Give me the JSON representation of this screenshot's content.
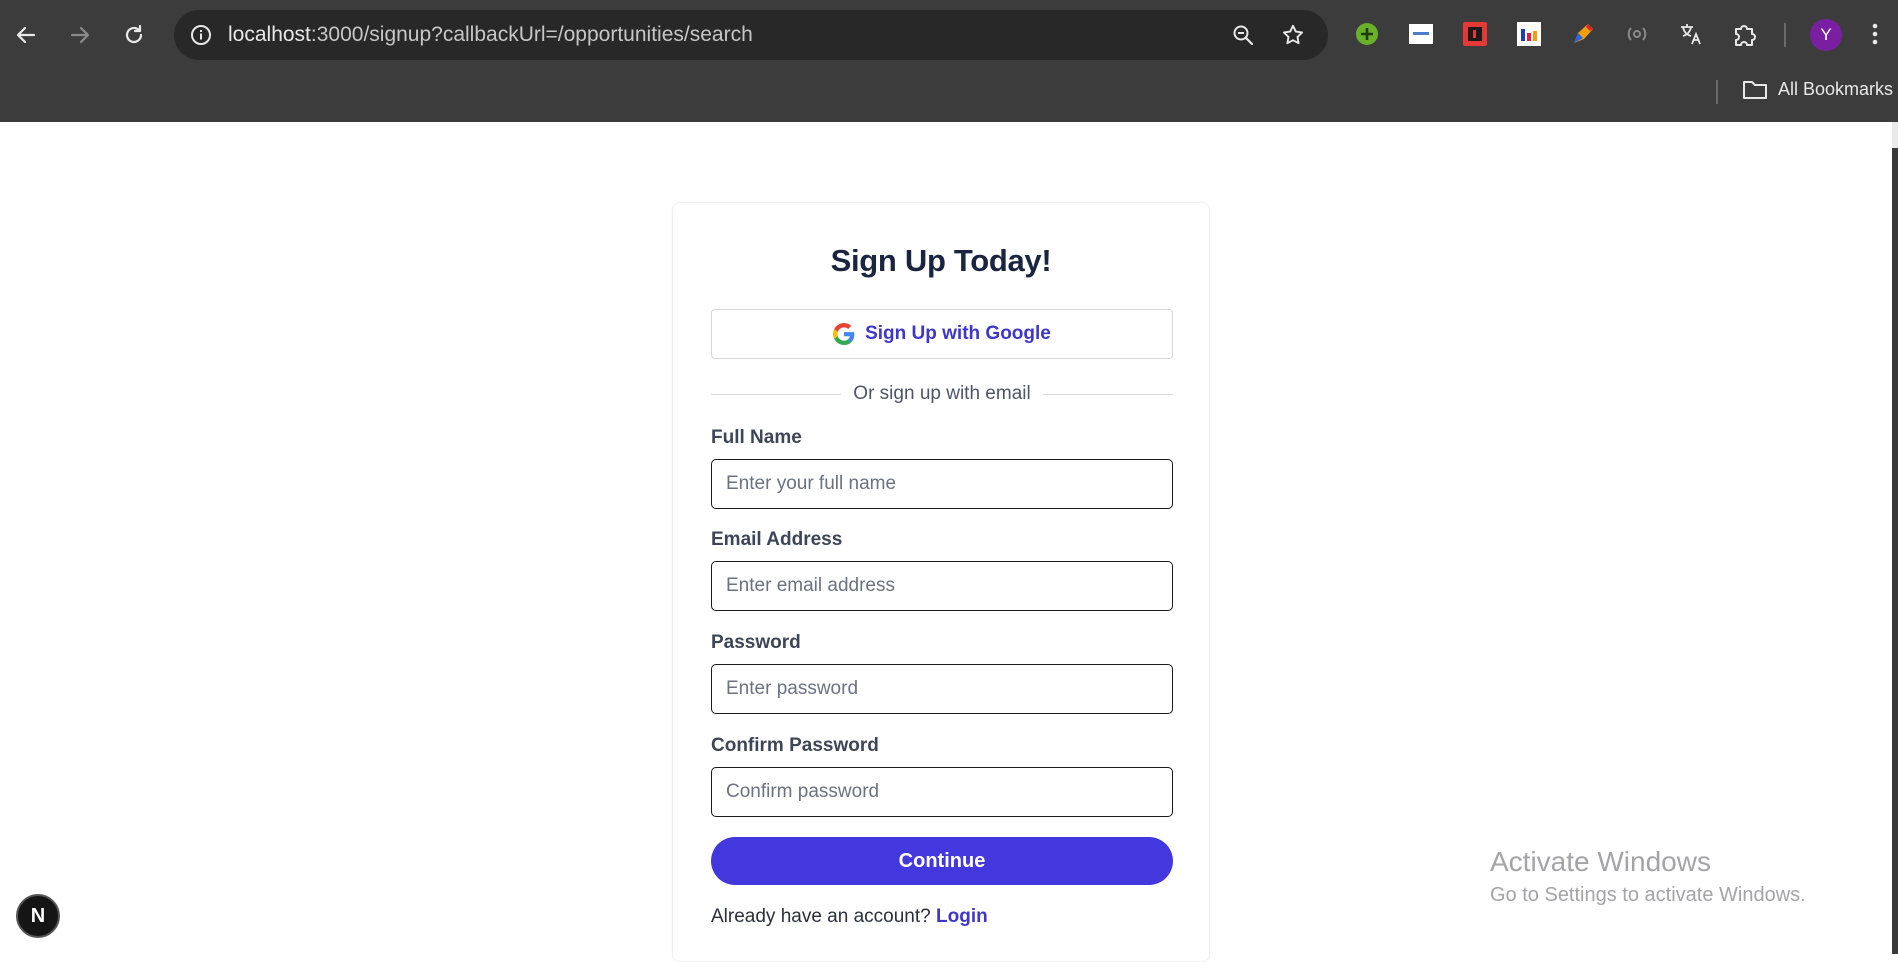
{
  "browser": {
    "url_host": "localhost",
    "url_rest": ":3000/signup?callbackUrl=/opportunities/search",
    "all_bookmarks_label": "All Bookmarks",
    "profile_initial": "Y",
    "extensions": [
      "plus-circle-extension",
      "apsy-extension",
      "red-badge-extension",
      "chart-extension",
      "pencil-extension",
      "broadcast-extension",
      "translate-extension",
      "puzzle-extension"
    ]
  },
  "signup": {
    "title": "Sign Up Today!",
    "google_label": "Sign Up with Google",
    "divider_text": "Or sign up with email",
    "fields": [
      {
        "label": "Full Name",
        "placeholder": "Enter your full name",
        "value": ""
      },
      {
        "label": "Email Address",
        "placeholder": "Enter email address",
        "value": ""
      },
      {
        "label": "Password",
        "placeholder": "Enter password",
        "value": ""
      },
      {
        "label": "Confirm Password",
        "placeholder": "Confirm password",
        "value": ""
      }
    ],
    "continue_label": "Continue",
    "login_prompt": "Already have an account?",
    "login_link": "Login"
  },
  "windows": {
    "line1": "Activate Windows",
    "line2": "Go to Settings to activate Windows."
  },
  "dev_badge": "N",
  "colors": {
    "accent": "#4338dd",
    "title": "#1b2540",
    "chrome_bg": "#3c3c3c"
  }
}
